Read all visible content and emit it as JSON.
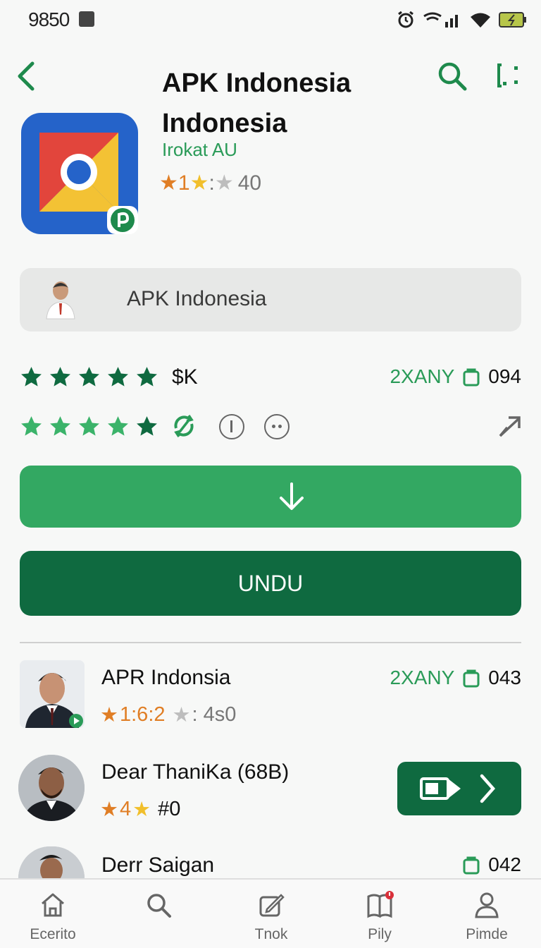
{
  "status_bar": {
    "time": "9850"
  },
  "app": {
    "title": "APK Indonesia Indonesia",
    "developer": "Irokat AU",
    "rating_text": "1",
    "rating_sep": ":",
    "rating_count": "40"
  },
  "developer_chip": {
    "label": "APK Indonesia"
  },
  "rating_row_1": {
    "value": "$K",
    "right_label": "2XANY",
    "right_value": "094"
  },
  "download_button": {
    "icon": "download-arrow-icon"
  },
  "primary_button": {
    "label": "UNDU"
  },
  "list": [
    {
      "title": "APR Indonsia",
      "rating": "1:6:2",
      "rating_tail": ": 4s0",
      "right_label": "2XANY",
      "right_value": "043"
    },
    {
      "title": "Dear ThaniKa (68B)",
      "rating": "4",
      "rating_tail": "#0"
    },
    {
      "title": "Derr Saigan",
      "right_value": "042"
    }
  ],
  "bottom_nav": [
    {
      "label": "Ecerito",
      "icon": "home-icon"
    },
    {
      "label": "",
      "icon": "search-icon"
    },
    {
      "label": "Tnok",
      "icon": "edit-icon"
    },
    {
      "label": "Pily",
      "icon": "book-icon"
    },
    {
      "label": "Pimde",
      "icon": "profile-icon"
    }
  ],
  "colors": {
    "accent": "#33a862",
    "accent_dark": "#0f6a40",
    "star_dark": "#0f6a40",
    "star_light": "#33a862",
    "star_orange": "#e07e25",
    "star_yellow": "#f1bf2b"
  }
}
